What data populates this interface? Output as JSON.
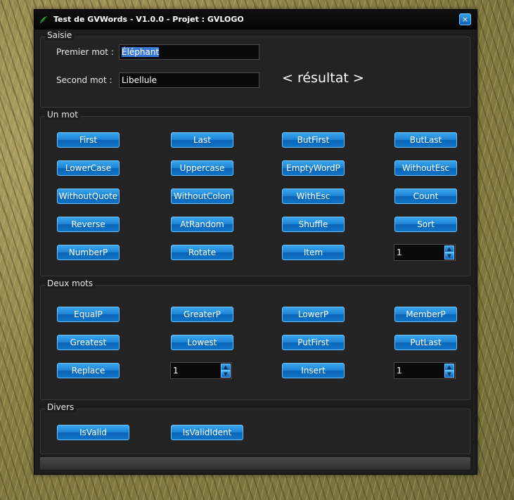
{
  "window": {
    "title": "Test de GVWords - V1.0.0 - Projet : GVLOGO",
    "close_label": "×"
  },
  "saisie": {
    "group_title": "Saisie",
    "premier_label": "Premier mot :",
    "premier_value": "Éléphant",
    "second_label": "Second mot :",
    "second_value": "Libellule",
    "result": "< résultat >"
  },
  "un_mot": {
    "group_title": "Un mot",
    "buttons": [
      "First",
      "Last",
      "ButFirst",
      "ButLast",
      "LowerCase",
      "Uppercase",
      "EmptyWordP",
      "WithoutEsc",
      "WithoutQuote",
      "WithoutColon",
      "WithEsc",
      "Count",
      "Reverse",
      "AtRandom",
      "Shuffle",
      "Sort",
      "NumberP",
      "Rotate",
      "Item"
    ],
    "spin_value": "1"
  },
  "deux_mots": {
    "group_title": "Deux mots",
    "buttons": [
      "EqualP",
      "GreaterP",
      "LowerP",
      "MemberP",
      "Greatest",
      "Lowest",
      "PutFirst",
      "PutLast",
      "Replace",
      "Insert"
    ],
    "spin1_value": "1",
    "spin2_value": "1"
  },
  "divers": {
    "group_title": "Divers",
    "buttons": [
      "IsValid",
      "IsValidIdent"
    ]
  },
  "colors": {
    "accent": "#1b84d6",
    "window_bg": "#1d1d1d"
  }
}
